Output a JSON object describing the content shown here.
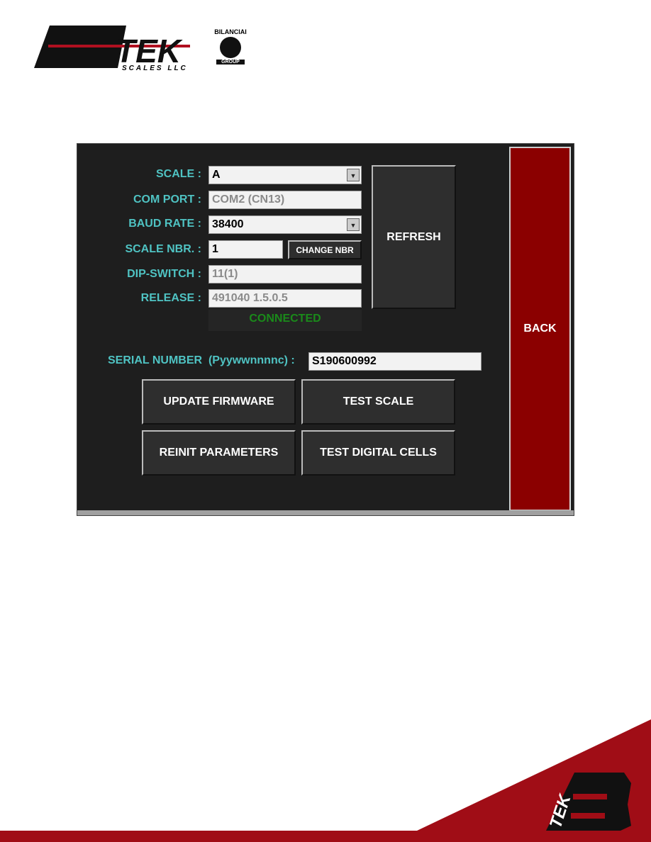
{
  "logo": {
    "brand": "B-TEK",
    "sub": "SCALES LLC",
    "partner": "BILANCIAI",
    "partner_sub": "GROUP"
  },
  "form": {
    "scale": {
      "label": "SCALE :",
      "value": "A"
    },
    "com_port": {
      "label": "COM PORT :",
      "value": "COM2 (CN13)"
    },
    "baud_rate": {
      "label": "BAUD RATE :",
      "value": "38400"
    },
    "scale_nbr": {
      "label": "SCALE NBR. :",
      "value": "1",
      "button": "CHANGE NBR"
    },
    "dip_switch": {
      "label": "DIP-SWITCH :",
      "value": "11(1)"
    },
    "release": {
      "label": "RELEASE :",
      "value": "491040 1.5.0.5"
    },
    "status": "CONNECTED",
    "serial": {
      "label": "SERIAL NUMBER  (Pyywwnnnnc) :",
      "value": "S190600992"
    }
  },
  "buttons": {
    "refresh": "REFRESH",
    "back": "BACK",
    "update_firmware": "UPDATE FIRMWARE",
    "test_scale": "TEST SCALE",
    "reinit_parameters": "REINIT PARAMETERS",
    "test_digital_cells": "TEST DIGITAL CELLS"
  },
  "colors": {
    "label": "#4fc3c3",
    "status": "#1a8a1a",
    "back": "#8b0000",
    "brand_red": "#a00d16"
  }
}
